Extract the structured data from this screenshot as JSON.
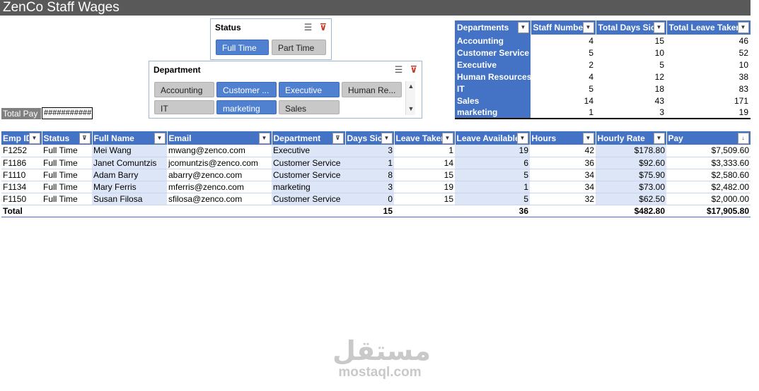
{
  "title": "ZenCo Staff Wages",
  "status_slicer": {
    "title": "Status",
    "items": [
      {
        "label": "Full Time",
        "selected": true
      },
      {
        "label": "Part Time",
        "selected": false
      }
    ]
  },
  "department_slicer": {
    "title": "Department",
    "items": [
      {
        "label": "Accounting",
        "selected": false
      },
      {
        "label": "Customer ...",
        "selected": true
      },
      {
        "label": "Executive",
        "selected": true
      },
      {
        "label": "Human Re...",
        "selected": false
      },
      {
        "label": "IT",
        "selected": false
      },
      {
        "label": "marketing",
        "selected": true
      },
      {
        "label": "Sales",
        "selected": false
      }
    ]
  },
  "total_pay": {
    "label": "Total Pay",
    "value": "###########"
  },
  "pivot": {
    "headers": [
      "Departments",
      "Staff Numbe",
      "Total Days Sick",
      "Total Leave Taken"
    ],
    "rows": [
      [
        "Accounting",
        "4",
        "15",
        "46"
      ],
      [
        "Customer Service",
        "5",
        "10",
        "52"
      ],
      [
        "Executive",
        "2",
        "5",
        "10"
      ],
      [
        "Human Resources",
        "4",
        "12",
        "38"
      ],
      [
        "IT",
        "5",
        "18",
        "83"
      ],
      [
        "Sales",
        "14",
        "43",
        "171"
      ],
      [
        "marketing",
        "1",
        "3",
        "19"
      ]
    ]
  },
  "main_table": {
    "headers": [
      "Emp ID",
      "Status",
      "Full Name",
      "Email",
      "Department",
      "Days Sick",
      "Leave Taken",
      "Leave Available",
      "Hours",
      "Hourly Rate",
      "Pay"
    ],
    "rows": [
      [
        "F1252",
        "Full Time",
        "Mei Wang",
        "mwang@zenco.com",
        "Executive",
        "3",
        "1",
        "19",
        "42",
        "$178.80",
        "$7,509.60"
      ],
      [
        "F1186",
        "Full Time",
        "Janet Comuntzis",
        "jcomuntzis@zenco.com",
        "Customer Service",
        "1",
        "14",
        "6",
        "36",
        "$92.60",
        "$3,333.60"
      ],
      [
        "F1110",
        "Full Time",
        "Adam Barry",
        "abarry@zenco.com",
        "Customer Service",
        "8",
        "15",
        "5",
        "34",
        "$75.90",
        "$2,580.60"
      ],
      [
        "F1134",
        "Full Time",
        "Mary Ferris",
        "mferris@zenco.com",
        "marketing",
        "3",
        "19",
        "1",
        "34",
        "$73.00",
        "$2,482.00"
      ],
      [
        "F1150",
        "Full Time",
        "Susan Filosa",
        "sfilosa@zenco.com",
        "Customer Service",
        "0",
        "15",
        "5",
        "32",
        "$62.50",
        "$2,000.00"
      ]
    ],
    "total": {
      "label": "Total",
      "days_sick": "15",
      "leave_available": "36",
      "hourly_rate": "$482.80",
      "pay": "$17,905.80"
    }
  },
  "watermark": {
    "arabic": "مستقل",
    "english": "mostaql.com"
  },
  "colors": {
    "header_blue": "#4472c4",
    "band_blue": "#dce6f6",
    "title_gray": "#595959",
    "slicer_selected": "#4f81d0",
    "slicer_unselected": "#c8c8c8"
  },
  "icons": [
    "multi-select-icon",
    "clear-filter-icon",
    "dropdown-arrow-icon",
    "filter-icon",
    "sort-icon",
    "scroll-up-icon",
    "scroll-down-icon"
  ]
}
